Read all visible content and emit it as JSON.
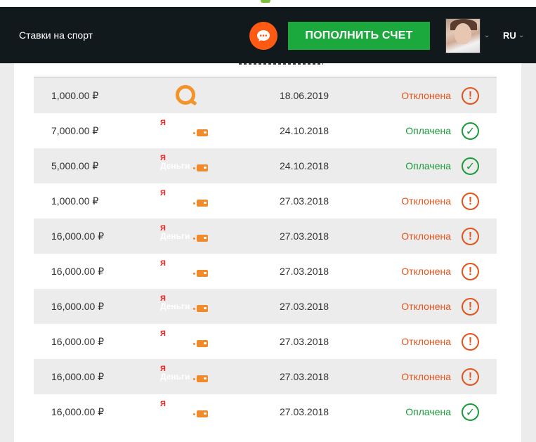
{
  "header": {
    "brand": "Ставки на спорт",
    "deposit_label": "ПОПОЛНИТЬ СЧЕТ",
    "language": "RU",
    "colors": {
      "background": "#12191d",
      "deposit": "#1ba83c",
      "chat": "#ff5a14"
    }
  },
  "transactions": [
    {
      "amount": "1,000.00 ₽",
      "method": "qiwi",
      "date": "18.06.2019",
      "status": "Отклонена",
      "state": "rejected"
    },
    {
      "amount": "7,000.00 ₽",
      "method": "yandex-money",
      "ym_letter": "Я",
      "ym_text": "",
      "date": "24.10.2018",
      "status": "Оплачена",
      "state": "paid"
    },
    {
      "amount": "5,000.00 ₽",
      "method": "yandex-money",
      "ym_letter": "Я",
      "ym_text": "Деньги",
      "date": "24.10.2018",
      "status": "Оплачена",
      "state": "paid"
    },
    {
      "amount": "1,000.00 ₽",
      "method": "yandex-money",
      "ym_letter": "Я",
      "ym_text": "",
      "date": "27.03.2018",
      "status": "Отклонена",
      "state": "rejected"
    },
    {
      "amount": "16,000.00 ₽",
      "method": "yandex-money",
      "ym_letter": "Я",
      "ym_text": "Деньги",
      "date": "27.03.2018",
      "status": "Отклонена",
      "state": "rejected"
    },
    {
      "amount": "16,000.00 ₽",
      "method": "yandex-money",
      "ym_letter": "Я",
      "ym_text": "",
      "date": "27.03.2018",
      "status": "Отклонена",
      "state": "rejected"
    },
    {
      "amount": "16,000.00 ₽",
      "method": "yandex-money",
      "ym_letter": "Я",
      "ym_text": "Деньги",
      "date": "27.03.2018",
      "status": "Отклонена",
      "state": "rejected"
    },
    {
      "amount": "16,000.00 ₽",
      "method": "yandex-money",
      "ym_letter": "Я",
      "ym_text": "",
      "date": "27.03.2018",
      "status": "Отклонена",
      "state": "rejected"
    },
    {
      "amount": "16,000.00 ₽",
      "method": "yandex-money",
      "ym_letter": "Я",
      "ym_text": "Деньги",
      "date": "27.03.2018",
      "status": "Отклонена",
      "state": "rejected"
    },
    {
      "amount": "16,000.00 ₽",
      "method": "yandex-money",
      "ym_letter": "Я",
      "ym_text": "",
      "date": "27.03.2018",
      "status": "Оплачена",
      "state": "paid"
    }
  ],
  "status_icons": {
    "paid": "check-circle-icon",
    "rejected": "exclamation-circle-icon"
  },
  "status_colors": {
    "paid": "#1a9a3a",
    "rejected": "#e4531a"
  }
}
